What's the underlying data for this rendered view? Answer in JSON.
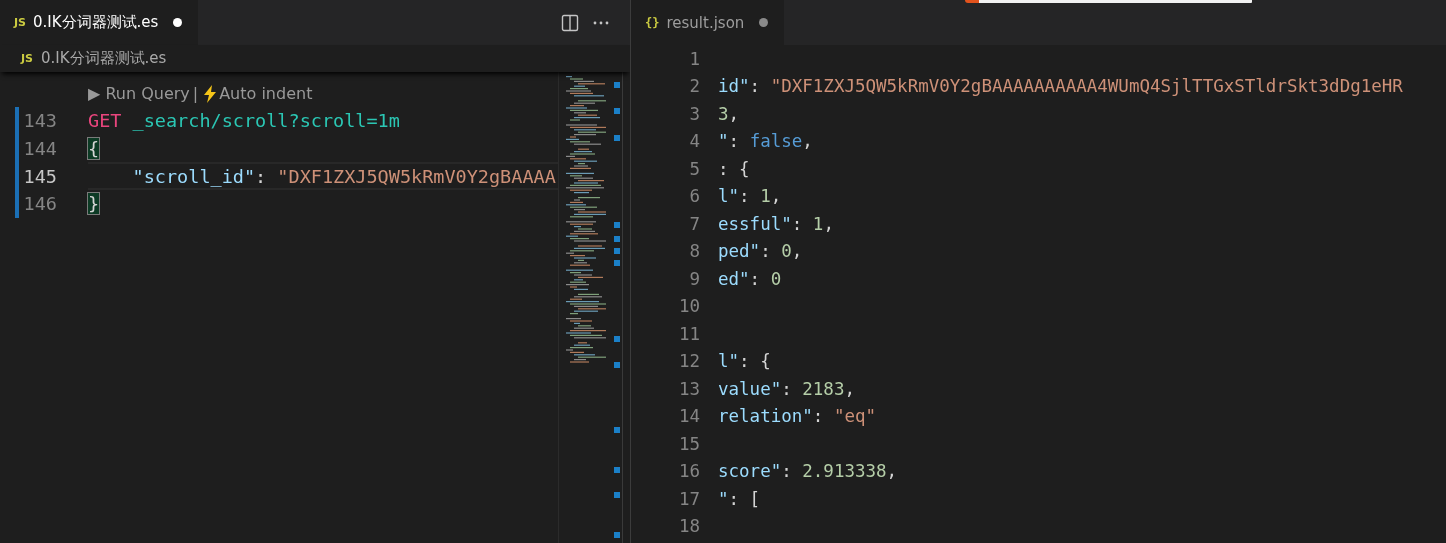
{
  "left_editor": {
    "tabs": [
      {
        "icon_text": "JS",
        "label": "0.IK分词器测试.es",
        "selected": true,
        "dirty": true
      }
    ],
    "breadcrumb": {
      "icon_text": "JS",
      "label": "0.IK分词器测试.es"
    },
    "codelens": [
      {
        "text": "▶ Run Query",
        "kind": "link"
      },
      {
        "text": "|",
        "kind": "separator"
      },
      {
        "text": "Auto indent",
        "kind": "bolt-link"
      }
    ],
    "lines": [
      {
        "number": "143",
        "modified": true,
        "current": false,
        "tokens": [
          {
            "text": "GET",
            "kind": "method"
          },
          {
            "text": " _search/scroll?scroll=1m",
            "kind": "path"
          }
        ]
      },
      {
        "number": "144",
        "modified": true,
        "current": false,
        "tokens": [
          {
            "text": "{",
            "kind": "bracket",
            "matched": true
          }
        ]
      },
      {
        "number": "145",
        "modified": true,
        "current": true,
        "tokens": [
          {
            "text": "    \"scroll_id\"",
            "kind": "key"
          },
          {
            "text": ": ",
            "kind": "punct"
          },
          {
            "text": "\"DXF1ZXJ5QW5kRmV0Y2gBAAAA",
            "kind": "string"
          }
        ]
      },
      {
        "number": "146",
        "modified": true,
        "current": false,
        "tokens": [
          {
            "text": "}",
            "kind": "bracket",
            "matched": true
          }
        ]
      }
    ]
  },
  "right_editor": {
    "tabs": [
      {
        "icon_text": "{}",
        "label": "result.json",
        "selected": false,
        "dirty": true
      }
    ],
    "lines": [
      {
        "number": "1"
      },
      {
        "number": "2",
        "tokens": [
          {
            "text": "id\"",
            "kind": "key"
          },
          {
            "text": ": ",
            "kind": "punct"
          },
          {
            "text": "\"DXF1ZXJ5QW5kRmV0Y2gBAAAAAAAAAA4WUmQ4SjlTTGxSTldrSkt3dDg1eHR",
            "kind": "string"
          }
        ]
      },
      {
        "number": "3",
        "tokens": [
          {
            "text": "3",
            "kind": "number"
          },
          {
            "text": ",",
            "kind": "punct"
          }
        ]
      },
      {
        "number": "4",
        "tokens": [
          {
            "text": "\"",
            "kind": "key"
          },
          {
            "text": ": ",
            "kind": "punct"
          },
          {
            "text": "false",
            "kind": "bool"
          },
          {
            "text": ",",
            "kind": "punct"
          }
        ]
      },
      {
        "number": "5",
        "tokens": [
          {
            "text": ": {",
            "kind": "punct"
          }
        ]
      },
      {
        "number": "6",
        "tokens": [
          {
            "text": "l\"",
            "kind": "key"
          },
          {
            "text": ": ",
            "kind": "punct"
          },
          {
            "text": "1",
            "kind": "number"
          },
          {
            "text": ",",
            "kind": "punct"
          }
        ]
      },
      {
        "number": "7",
        "tokens": [
          {
            "text": "essful\"",
            "kind": "key"
          },
          {
            "text": ": ",
            "kind": "punct"
          },
          {
            "text": "1",
            "kind": "number"
          },
          {
            "text": ",",
            "kind": "punct"
          }
        ]
      },
      {
        "number": "8",
        "tokens": [
          {
            "text": "ped\"",
            "kind": "key"
          },
          {
            "text": ": ",
            "kind": "punct"
          },
          {
            "text": "0",
            "kind": "number"
          },
          {
            "text": ",",
            "kind": "punct"
          }
        ]
      },
      {
        "number": "9",
        "tokens": [
          {
            "text": "ed\"",
            "kind": "key"
          },
          {
            "text": ": ",
            "kind": "punct"
          },
          {
            "text": "0",
            "kind": "number"
          }
        ]
      },
      {
        "number": "10"
      },
      {
        "number": "11"
      },
      {
        "number": "12",
        "tokens": [
          {
            "text": "l\"",
            "kind": "key"
          },
          {
            "text": ": {",
            "kind": "punct"
          }
        ]
      },
      {
        "number": "13",
        "tokens": [
          {
            "text": "value\"",
            "kind": "key"
          },
          {
            "text": ": ",
            "kind": "punct"
          },
          {
            "text": "2183",
            "kind": "number"
          },
          {
            "text": ",",
            "kind": "punct"
          }
        ]
      },
      {
        "number": "14",
        "tokens": [
          {
            "text": "relation\"",
            "kind": "key"
          },
          {
            "text": ": ",
            "kind": "punct"
          },
          {
            "text": "\"eq\"",
            "kind": "string"
          }
        ]
      },
      {
        "number": "15"
      },
      {
        "number": "16",
        "tokens": [
          {
            "text": "score\"",
            "kind": "key"
          },
          {
            "text": ": ",
            "kind": "punct"
          },
          {
            "text": "2.913338",
            "kind": "number"
          },
          {
            "text": ",",
            "kind": "punct"
          }
        ]
      },
      {
        "number": "17",
        "tokens": [
          {
            "text": "\"",
            "kind": "key"
          },
          {
            "text": ": [",
            "kind": "punct"
          }
        ]
      },
      {
        "number": "18"
      }
    ]
  }
}
